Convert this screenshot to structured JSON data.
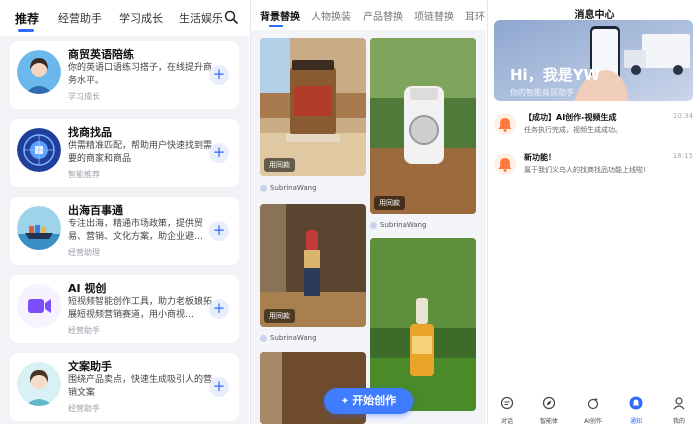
{
  "panel1": {
    "tabs": [
      "推荐",
      "经营助手",
      "学习成长",
      "生活娱乐"
    ],
    "cards": [
      {
        "title": "商贸英语陪练",
        "desc": "你的英语口语练习搭子，在线提升商务水平。",
        "tag": "学习成长",
        "icon": "businesswoman-avatar-icon"
      },
      {
        "title": "找商找品",
        "desc": "供需精准匹配，帮助用户快速找到需要的商家和商品",
        "tag": "智能推荐",
        "icon": "globe-chip-icon"
      },
      {
        "title": "出海百事通",
        "desc": "专注出海，精通市场政策，提供贸易、营销、文化方案，助企业避…",
        "tag": "经营助理",
        "icon": "cargo-ship-icon"
      },
      {
        "title": "AI 视创",
        "desc": "短视频智能创作工具，助力老板娘拓展短视频营销赛道，用小商视…",
        "tag": "经营助手",
        "icon": "video-camera-icon"
      },
      {
        "title": "文案助手",
        "desc": "围绕产品卖点，快速生成吸引人的营销文案",
        "tag": "经营助手",
        "icon": "woman-avatar-icon"
      }
    ]
  },
  "panel2": {
    "tabs": [
      "背景替换",
      "人物换装",
      "产品替换",
      "项链替换",
      "耳环替换"
    ],
    "badge": "用同款",
    "author": "SubrinaWang",
    "fab_label": "开始创作"
  },
  "panel3": {
    "title": "消息中心",
    "banner_title": "Hi，我是YW",
    "banner_subtitle": "你的智能商贸助手",
    "messages": [
      {
        "title": "【成功】AI创作-视频生成",
        "desc": "任务执行完成，视频生成成功。",
        "time": "10:34"
      },
      {
        "title": "新功能！",
        "desc": "属于我们义乌人的找商找品功能上线啦!",
        "time": "18:15"
      }
    ],
    "nav": [
      "对话",
      "智能体",
      "AI创作",
      "通知",
      "我的"
    ]
  },
  "colors": {
    "accent": "#2f6bff",
    "fab": "#3f7cff"
  }
}
